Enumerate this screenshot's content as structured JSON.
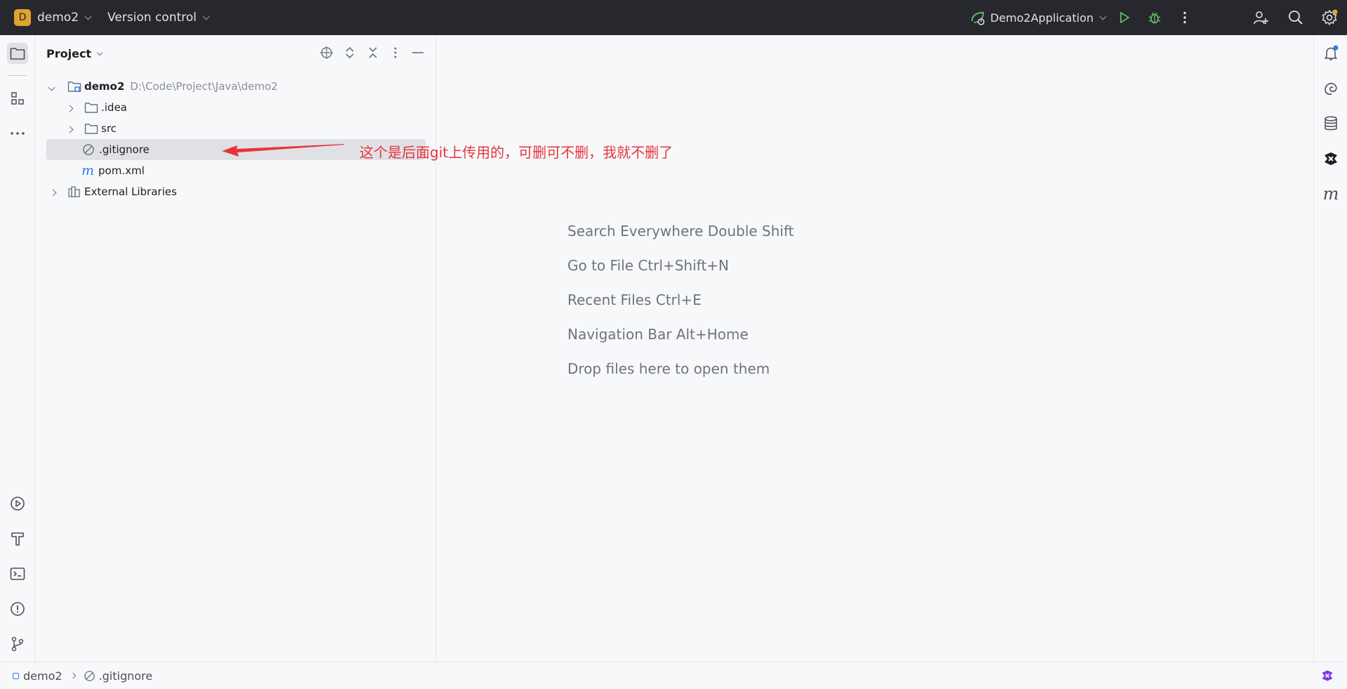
{
  "titlebar": {
    "project_initial": "D",
    "project_name": "demo2",
    "vcs_label": "Version control",
    "run_config": "Demo2Application",
    "colors": {
      "background": "#27282e",
      "badge": "#e0a32e",
      "run": "#5fb865"
    }
  },
  "left_toolbar": {
    "icons": [
      "folder-icon",
      "structure-icon",
      "more-icon",
      "run-icon",
      "build-icon",
      "terminal-icon",
      "problems-icon",
      "git-icon"
    ]
  },
  "right_toolbar": {
    "icons": [
      "notifications-icon",
      "ai-assistant-icon",
      "database-icon",
      "tool-icon",
      "maven-icon"
    ]
  },
  "project_panel": {
    "title": "Project",
    "tree": [
      {
        "label": "demo2",
        "path": "D:\\Code\\Project\\Java\\demo2",
        "expanded": true,
        "icon": "module-folder-icon"
      },
      {
        "label": ".idea",
        "expanded": false,
        "icon": "folder-icon"
      },
      {
        "label": "src",
        "expanded": false,
        "icon": "folder-icon"
      },
      {
        "label": ".gitignore",
        "icon": "ignore-file-icon",
        "selected": true
      },
      {
        "label": "pom.xml",
        "icon": "maven-file-icon"
      },
      {
        "label": "External Libraries",
        "expanded": false,
        "icon": "library-icon"
      }
    ]
  },
  "annotation": {
    "text": "这个是后面git上传用的，可删可不删，我就不删了",
    "color": "#e8333b"
  },
  "editor_hints": [
    "Search Everywhere Double Shift",
    "Go to File Ctrl+Shift+N",
    "Recent Files Ctrl+E",
    "Navigation Bar Alt+Home",
    "Drop files here to open them"
  ],
  "statusbar": {
    "breadcrumb": [
      "demo2",
      ".gitignore"
    ]
  }
}
